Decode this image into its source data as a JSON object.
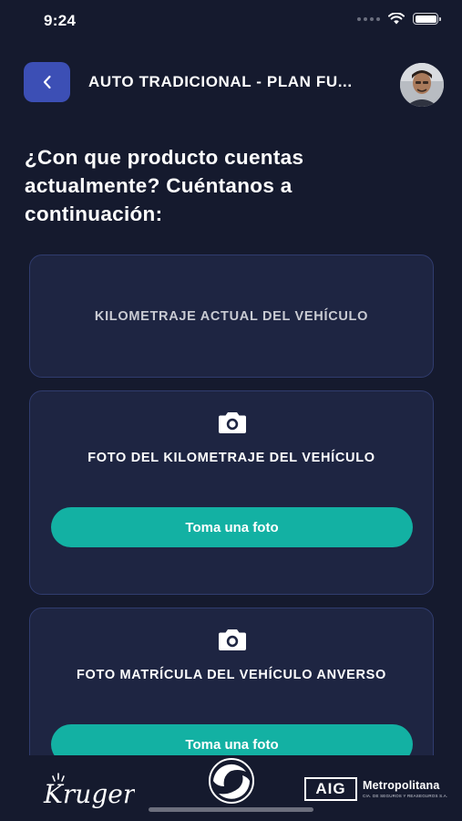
{
  "status_bar": {
    "time": "9:24"
  },
  "header": {
    "title": "AUTO TRADICIONAL - PLAN FU..."
  },
  "question": "¿Con que producto cuentas actualmente? Cuéntanos a continuación:",
  "cards": [
    {
      "label": "KILOMETRAJE ACTUAL DEL VEHÍCULO"
    },
    {
      "label": "FOTO DEL KILOMETRAJE DEL VEHÍCULO",
      "button": "Toma una foto"
    },
    {
      "label": "FOTO MATRÍCULA DEL VEHÍCULO ANVERSO",
      "button": "Toma una foto"
    }
  ],
  "footer": {
    "kruger": "Kruger",
    "aig": "AIG",
    "metropolitana": "Metropolitana",
    "metropolitana_sub": "CIA. DE SEGUROS Y REASEGUROS S.A."
  },
  "colors": {
    "background": "#151a2e",
    "card": "#1e2542",
    "accent_blue": "#3c4fb5",
    "accent_teal": "#13b1a3"
  },
  "icons": [
    "back-chevron-icon",
    "camera-icon",
    "wifi-icon",
    "battery-icon",
    "signal-icon"
  ]
}
